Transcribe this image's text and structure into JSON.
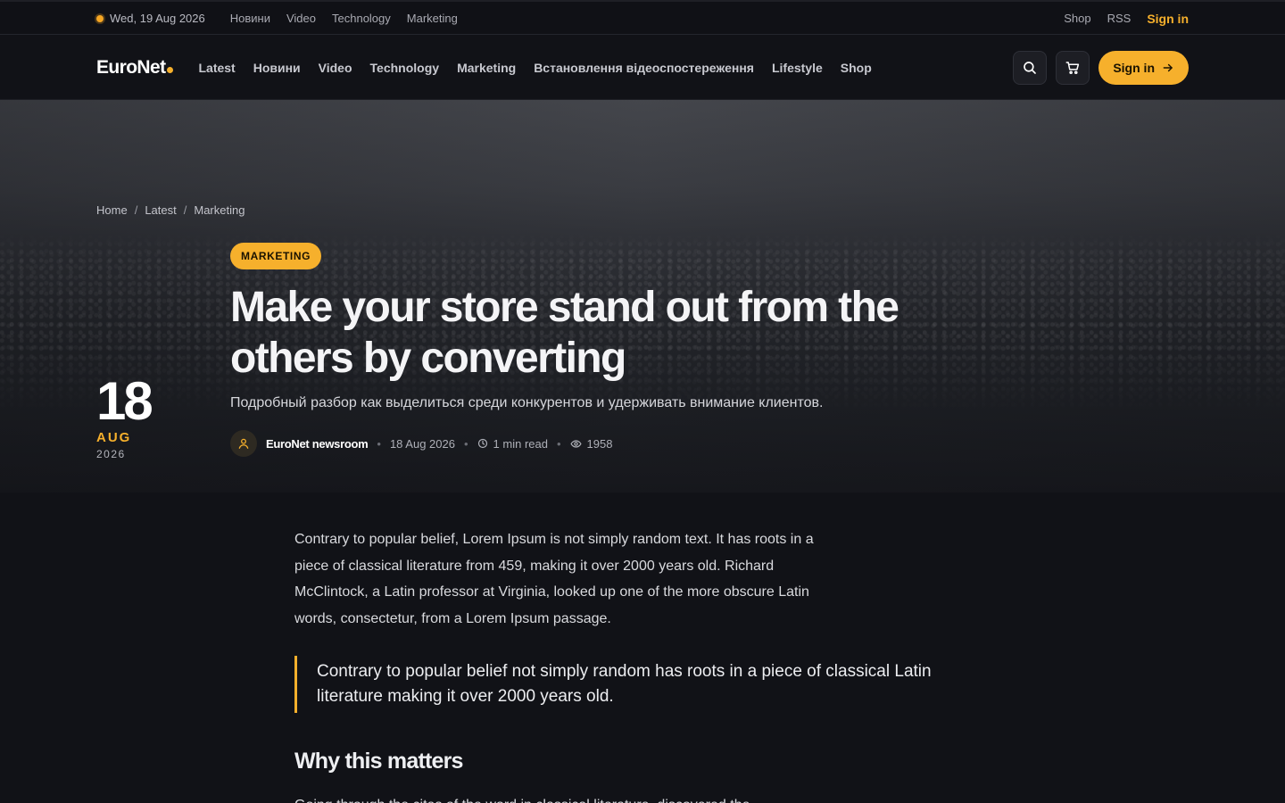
{
  "topbar": {
    "date": "Wed, 19 Aug 2026",
    "links": [
      "Новини",
      "Video",
      "Technology",
      "Marketing"
    ],
    "right_links": [
      "Shop",
      "RSS"
    ],
    "signin": "Sign in"
  },
  "nav": {
    "logo": "EuroNet",
    "links": [
      "Latest",
      "Новини",
      "Video",
      "Technology",
      "Marketing",
      "Встановлення відеоспостереження",
      "Lifestyle",
      "Shop"
    ],
    "signin": "Sign in"
  },
  "breadcrumb": [
    "Home",
    "Latest",
    "Marketing"
  ],
  "article": {
    "category": "MARKETING",
    "title": "Make your store stand out from the others by converting",
    "subtitle": "Подробный разбор как выделиться среди конкурентов и удерживать внимание клиентов.",
    "author": "EuroNet newsroom",
    "date": "18 Aug 2026",
    "read_time": "1 min read",
    "views": "1958",
    "big_day": "18",
    "big_month": "AUG",
    "big_year": "2026",
    "lead": "Contrary to popular belief, Lorem Ipsum is not simply random text. It has roots in a piece of classical literature from 459, making it over 2000 years old. Richard McClintock, a Latin professor at Virginia, looked up one of the more obscure Latin words, consectetur, from a Lorem Ipsum passage.",
    "quote": "Contrary to popular belief not simply random has roots in a piece of classical Latin literature making it over 2000 years old.",
    "heading": "Why this matters",
    "next_para": "Going through the cites of the word in classical literature, discovered the"
  },
  "colors": {
    "accent": "#f6b02c",
    "background": "#111217"
  }
}
